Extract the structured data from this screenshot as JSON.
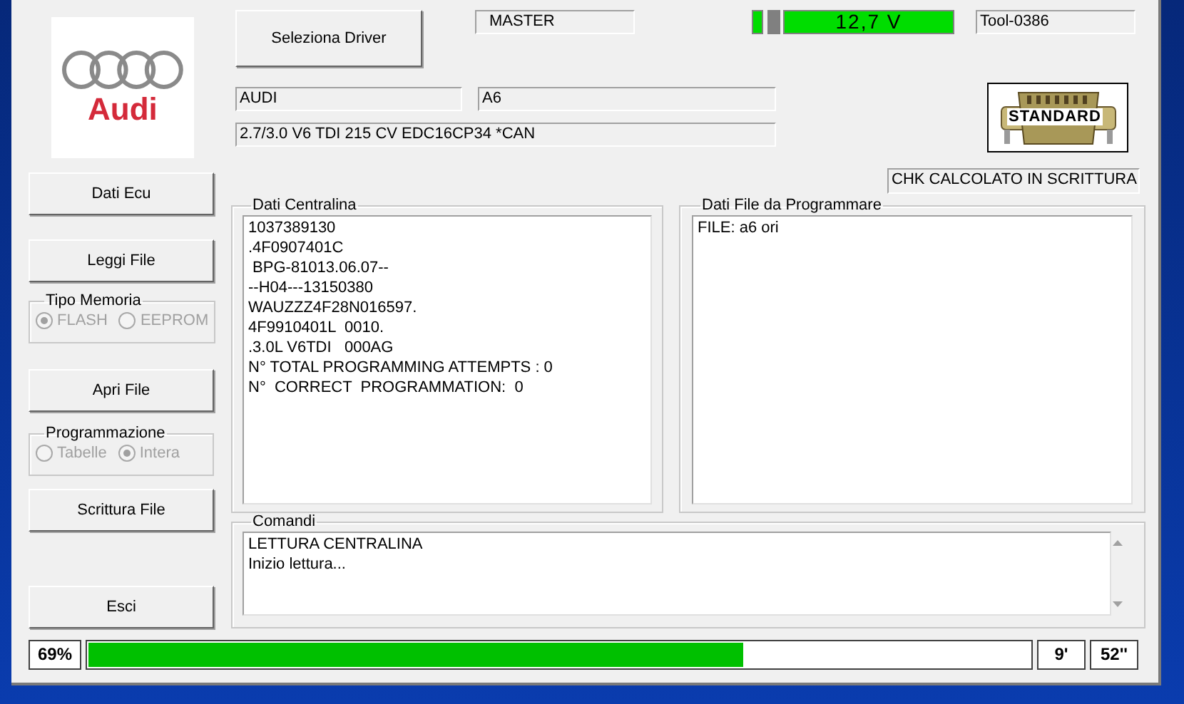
{
  "logo": {
    "text": "Audi"
  },
  "select_driver": "Seleziona Driver",
  "mode": "MASTER",
  "voltage": "12,7 V",
  "tool_id": "Tool-0386",
  "make": "AUDI",
  "model": "A6",
  "engine": "2.7/3.0 V6 TDI 215 CV EDC16CP34 *CAN",
  "connector": "STANDARD",
  "checksum_status": "CHK CALCOLATO IN SCRITTURA",
  "sidebar": [
    {
      "kind": "button",
      "label": "Dati Ecu"
    },
    {
      "kind": "button",
      "label": "Leggi File"
    },
    {
      "kind": "radio_group",
      "title": "Tipo Memoria",
      "disabled": true,
      "options": [
        {
          "label": "FLASH",
          "selected": true
        },
        {
          "label": "EEPROM",
          "selected": false
        }
      ]
    },
    {
      "kind": "button",
      "label": "Apri File"
    },
    {
      "kind": "radio_group",
      "title": "Programmazione",
      "disabled": true,
      "options": [
        {
          "label": "Tabelle",
          "selected": false
        },
        {
          "label": "Intera",
          "selected": true
        }
      ]
    },
    {
      "kind": "button",
      "label": "Scrittura File"
    },
    {
      "kind": "button",
      "label": "Esci"
    }
  ],
  "ecu_data": {
    "title": "Dati Centralina",
    "lines": [
      "1037389130",
      ".4F0907401C",
      " BPG-81013.06.07--",
      "--H04---13150380",
      "WAUZZZ4F28N016597.",
      "4F9910401L  0010.",
      ".3.0L V6TDI   000AG",
      "N° TOTAL PROGRAMMING ATTEMPTS : 0",
      "N°  CORRECT  PROGRAMMATION:  0"
    ]
  },
  "file_data": {
    "title": "Dati File da Programmare",
    "lines": [
      "FILE: a6 ori"
    ]
  },
  "commands": {
    "title": "Comandi",
    "lines": [
      "LETTURA CENTRALINA",
      "Inizio lettura..."
    ]
  },
  "progress": {
    "percent": "69%",
    "level": 0.695,
    "minutes": "9'",
    "seconds": "52''"
  }
}
